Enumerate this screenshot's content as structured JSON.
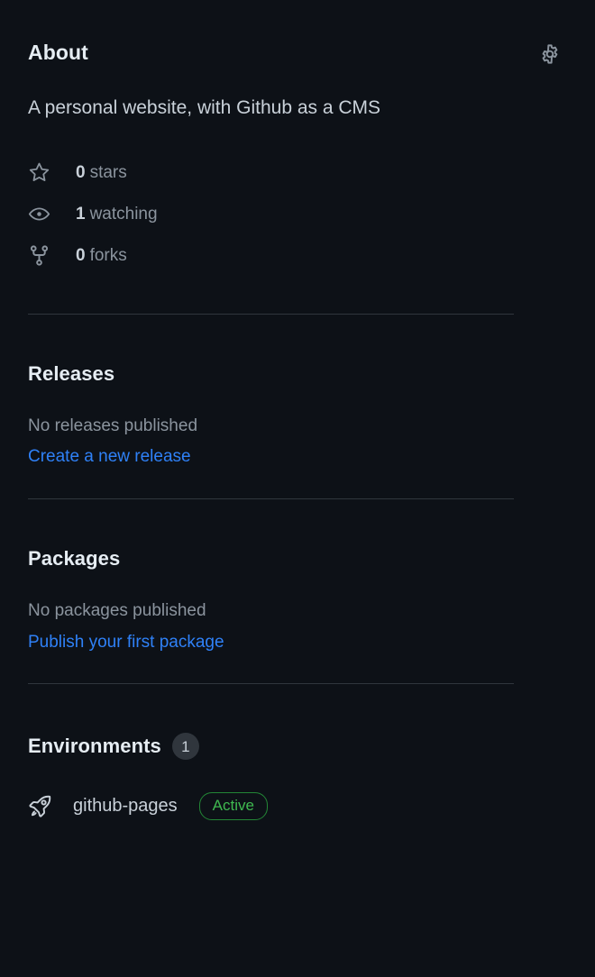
{
  "about": {
    "title": "About",
    "settings_icon": "gear-icon",
    "description": "A personal website, with Github as a CMS",
    "stats": [
      {
        "icon": "star-icon",
        "count": "0",
        "label": "stars"
      },
      {
        "icon": "eye-icon",
        "count": "1",
        "label": "watching"
      },
      {
        "icon": "fork-icon",
        "count": "0",
        "label": "forks"
      }
    ]
  },
  "releases": {
    "title": "Releases",
    "empty_text": "No releases published",
    "action_link": "Create a new release"
  },
  "packages": {
    "title": "Packages",
    "empty_text": "No packages published",
    "action_link": "Publish your first package"
  },
  "environments": {
    "title": "Environments",
    "count": "1",
    "items": [
      {
        "icon": "rocket-icon",
        "name": "github-pages",
        "status": "Active"
      }
    ]
  },
  "colors": {
    "background": "#0d1117",
    "text_primary": "#e6edf3",
    "text_secondary": "#c9d1d9",
    "text_muted": "#8b949e",
    "link": "#2f81f7",
    "divider": "#30363d",
    "badge_bg": "#30363d",
    "status_border": "#238636",
    "status_text": "#3fb950"
  }
}
